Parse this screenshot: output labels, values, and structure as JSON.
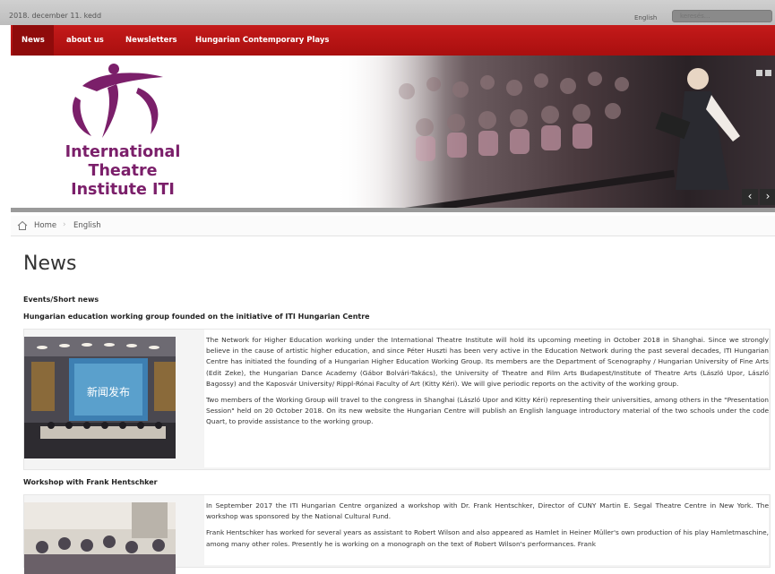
{
  "topbar": {
    "date": "2018. december 11. kedd",
    "language": "English",
    "search_placeholder": "keresés..."
  },
  "nav": {
    "items": [
      "News",
      "about us",
      "Newsletters",
      "Hungarian Contemporary Plays"
    ],
    "active_index": 0
  },
  "banner": {
    "logo_lines": [
      "International",
      "Theatre",
      "Institute ITI"
    ],
    "prev_symbol": "‹",
    "next_symbol": "›"
  },
  "breadcrumb": {
    "home": "Home",
    "separator": "›",
    "current": "English"
  },
  "page": {
    "title": "News",
    "section": "Events/Short news"
  },
  "articles": [
    {
      "title": "Hungarian education working group founded on the initiative of ITI Hungarian Centre",
      "image_caption": "新闻发布",
      "paragraphs": [
        "The Network for Higher Education working under the International Theatre Institute will hold its upcoming meeting in October 2018 in Shanghai. Since we strongly believe in the cause of artistic higher education, and since Péter Huszti has been very active in the Education Network during the past several decades, ITI Hungarian Centre has initiated the founding of a Hungarian Higher Education Working Group. Its members are the Department of Scenography / Hungarian University of Fine Arts (Edit Zeke), the Hungarian Dance Academy (Gábor Bolvári-Takács), the University of Theatre and Film Arts Budapest/Institute of Theatre Arts (László Upor, László Bagossy) and the Kaposvár University/ Rippl-Rónai Faculty of Art (Kitty Kéri). We will give periodic reports on the activity of the working group.",
        "Two members of the Working Group will travel to the congress in Shanghai (László Upor and Kitty Kéri) representing their universities, among others in the \"Presentation Session\" held on 20 October 2018. On its new website the Hungarian Centre will publish an English language introductory material of the two schools under the code Quart, to provide assistance to the working group."
      ]
    },
    {
      "title": "Workshop with Frank Hentschker",
      "paragraphs": [
        "In September 2017 the ITI Hungarian Centre organized a workshop with Dr. Frank Hentschker, Director of CUNY Martin E. Segal Theatre Centre in New York. The workshop was sponsored by the National Cultural Fund.",
        "Frank Hentschker has worked for several years as assistant to Robert Wilson and also appeared as Hamlet in Heiner Müller's own production of his play Hamletmaschine, among many other roles. Presently he is working on a monograph on the text of Robert Wilson's performances. Frank"
      ]
    }
  ],
  "colors": {
    "nav_red": "#b81414",
    "logo_purple": "#7b1f6a"
  }
}
